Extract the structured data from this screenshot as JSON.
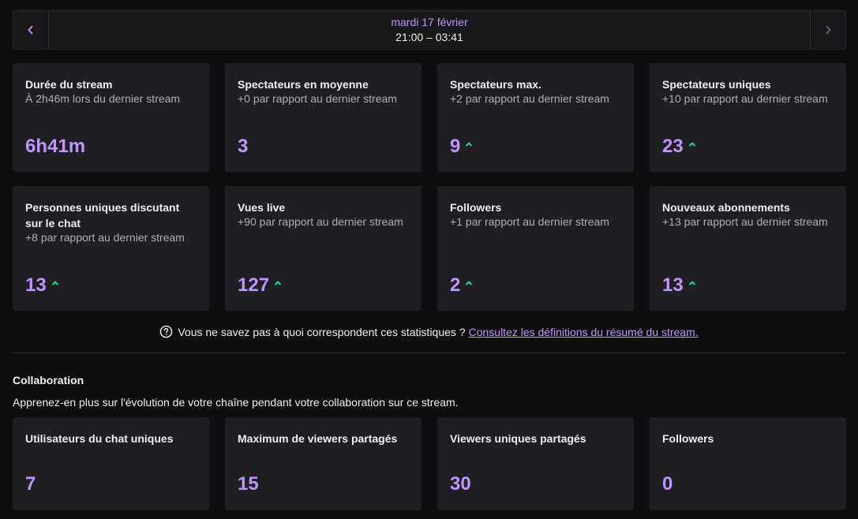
{
  "date_nav": {
    "prev_icon": "chevron-left-icon",
    "next_icon": "chevron-right-icon",
    "date": "mardi 17 février",
    "time_range": "21:00 – 03:41"
  },
  "stats": [
    {
      "title": "Durée du stream",
      "subtitle": "À 2h46m lors du dernier stream",
      "value": "6h41m",
      "trend": ""
    },
    {
      "title": "Spectateurs en moyenne",
      "subtitle": "+0 par rapport au dernier stream",
      "value": "3",
      "trend": ""
    },
    {
      "title": "Spectateurs max.",
      "subtitle": "+2 par rapport au dernier stream",
      "value": "9",
      "trend": "up"
    },
    {
      "title": "Spectateurs uniques",
      "subtitle": "+10 par rapport au dernier stream",
      "value": "23",
      "trend": "up"
    },
    {
      "title": "Personnes uniques discutant sur le chat",
      "subtitle": "+8 par rapport au dernier stream",
      "value": "13",
      "trend": "up"
    },
    {
      "title": "Vues live",
      "subtitle": "+90 par rapport au dernier stream",
      "value": "127",
      "trend": "up"
    },
    {
      "title": "Followers",
      "subtitle": "+1 par rapport au dernier stream",
      "value": "2",
      "trend": "up"
    },
    {
      "title": "Nouveaux abonnements",
      "subtitle": "+13 par rapport au dernier stream",
      "value": "13",
      "trend": "up"
    }
  ],
  "help": {
    "icon": "question-circle-icon",
    "text": "Vous ne savez pas à quoi correspondent ces statistiques ?",
    "link": "Consultez les définitions du résumé du stream."
  },
  "collaboration": {
    "title": "Collaboration",
    "description": "Apprenez-en plus sur l'évolution de votre chaîne pendant votre collaboration sur ce stream.",
    "stats": [
      {
        "title": "Utilisateurs du chat uniques",
        "value": "7"
      },
      {
        "title": "Maximum de viewers partagés",
        "value": "15"
      },
      {
        "title": "Viewers uniques partagés",
        "value": "30"
      },
      {
        "title": "Followers",
        "value": "0"
      }
    ]
  },
  "colors": {
    "accent": "#bf94ff",
    "trend_up": "#00f593",
    "card_bg": "#1f1f23",
    "page_bg": "#0e0e10"
  }
}
